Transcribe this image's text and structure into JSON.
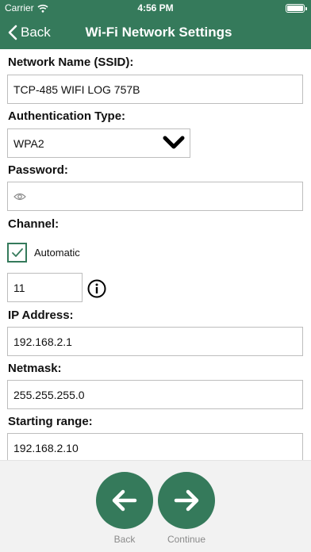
{
  "status_bar": {
    "carrier": "Carrier",
    "time": "4:56 PM"
  },
  "nav": {
    "back_label": "Back",
    "title": "Wi-Fi Network Settings"
  },
  "form": {
    "ssid": {
      "label": "Network Name (SSID):",
      "value": "TCP-485 WIFI LOG 757B"
    },
    "auth": {
      "label": "Authentication Type:",
      "value": "WPA2"
    },
    "password": {
      "label": "Password:",
      "value": ""
    },
    "channel": {
      "label": "Channel:",
      "automatic_label": "Automatic",
      "automatic_checked": true,
      "value": "11"
    },
    "ip": {
      "label": "IP Address:",
      "value": "192.168.2.1"
    },
    "netmask": {
      "label": "Netmask:",
      "value": "255.255.255.0"
    },
    "starting_range": {
      "label": "Starting range:",
      "value": "192.168.2.10"
    }
  },
  "footer": {
    "back_label": "Back",
    "continue_label": "Continue"
  },
  "colors": {
    "accent": "#357a5b",
    "footer_bg": "#f2f2f2",
    "caption": "#8a8a8a"
  },
  "icons": [
    "wifi-icon",
    "battery-icon",
    "chevron-left-icon",
    "chevron-down-icon",
    "eye-icon",
    "checkmark-icon",
    "info-icon",
    "arrow-left-icon",
    "arrow-right-icon"
  ]
}
